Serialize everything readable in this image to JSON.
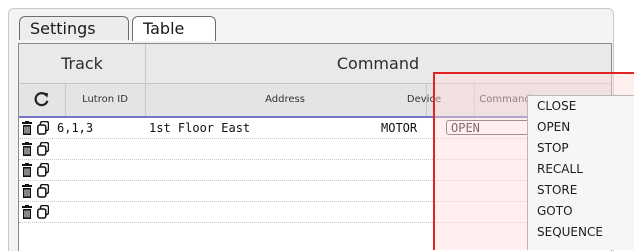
{
  "tabs": [
    {
      "label": "Settings"
    },
    {
      "label": "Table"
    }
  ],
  "header_groups": {
    "track": "Track",
    "command": "Command"
  },
  "columns": {
    "lutron_id": "Lutron ID",
    "address": "Address",
    "device": "Device",
    "command": "Command"
  },
  "rows": [
    {
      "lutron_id": "6,1,3",
      "address": "1st Floor East",
      "device": "MOTOR",
      "command": "OPEN"
    },
    {
      "lutron_id": "",
      "address": "",
      "device": "",
      "command": ""
    },
    {
      "lutron_id": "",
      "address": "",
      "device": "",
      "command": ""
    },
    {
      "lutron_id": "",
      "address": "",
      "device": "",
      "command": ""
    },
    {
      "lutron_id": "",
      "address": "",
      "device": "",
      "command": ""
    }
  ],
  "dropdown_options": [
    "CLOSE",
    "OPEN",
    "STOP",
    "RECALL",
    "STORE",
    "GOTO",
    "SEQUENCE"
  ],
  "colors": {
    "highlight_border": "#e02424",
    "header_separator": "#7575c8"
  },
  "icons": [
    "refresh-icon",
    "trash-icon",
    "copy-icon"
  ]
}
